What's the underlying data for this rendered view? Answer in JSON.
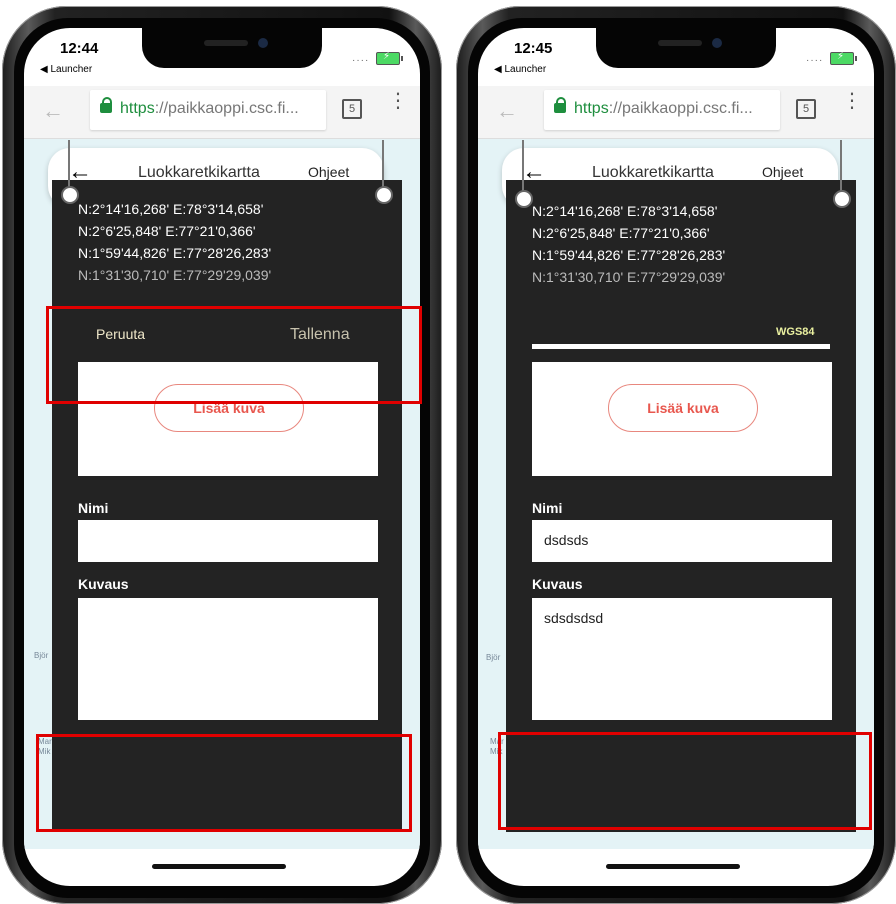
{
  "screens": [
    {
      "status": {
        "time": "12:44",
        "back_app": "◀ Launcher"
      },
      "browser": {
        "url_scheme": "https",
        "url_rest": "://paikkaoppi.csc.fi...",
        "tab_count": "5"
      },
      "app": {
        "title": "Luokkaretkikartta",
        "help": "Ohjeet"
      },
      "coords": [
        "N:2°14'16,268' E:78°3'14,658'",
        "N:2°6'25,848' E:77°21'0,366'",
        "N:1°59'44,826' E:77°28'26,283'",
        "N:1°31'30,710' E:77°29'29,039'"
      ],
      "actions": {
        "cancel": "Peruuta",
        "save": "Tallenna"
      },
      "add_image": "Lisää kuva",
      "name_label": "Nimi",
      "name_value": "",
      "desc_label": "Kuvaus",
      "desc_value": ""
    },
    {
      "status": {
        "time": "12:45",
        "back_app": "◀ Launcher"
      },
      "browser": {
        "url_scheme": "https",
        "url_rest": "://paikkaoppi.csc.fi...",
        "tab_count": "5"
      },
      "app": {
        "title": "Luokkaretkikartta",
        "help": "Ohjeet"
      },
      "coords": [
        "N:2°14'16,268' E:78°3'14,658'",
        "N:2°6'25,848' E:77°21'0,366'",
        "N:1°59'44,826' E:77°28'26,283'",
        "N:1°31'30,710' E:77°29'29,039'"
      ],
      "wgs": "WGS84",
      "add_image": "Lisää kuva",
      "name_label": "Nimi",
      "name_value": "dsdsds",
      "desc_label": "Kuvaus",
      "desc_value": "sdsdsdsd"
    }
  ],
  "map_labels": {
    "left": [
      "Björ",
      "Mar",
      "Mik"
    ],
    "right": [
      "Björ",
      "Mar",
      "Mik"
    ]
  },
  "colors": {
    "panel": "#232323",
    "highlight": "#e00000",
    "secure": "#1e8e3e",
    "accent": "#e8574e"
  }
}
